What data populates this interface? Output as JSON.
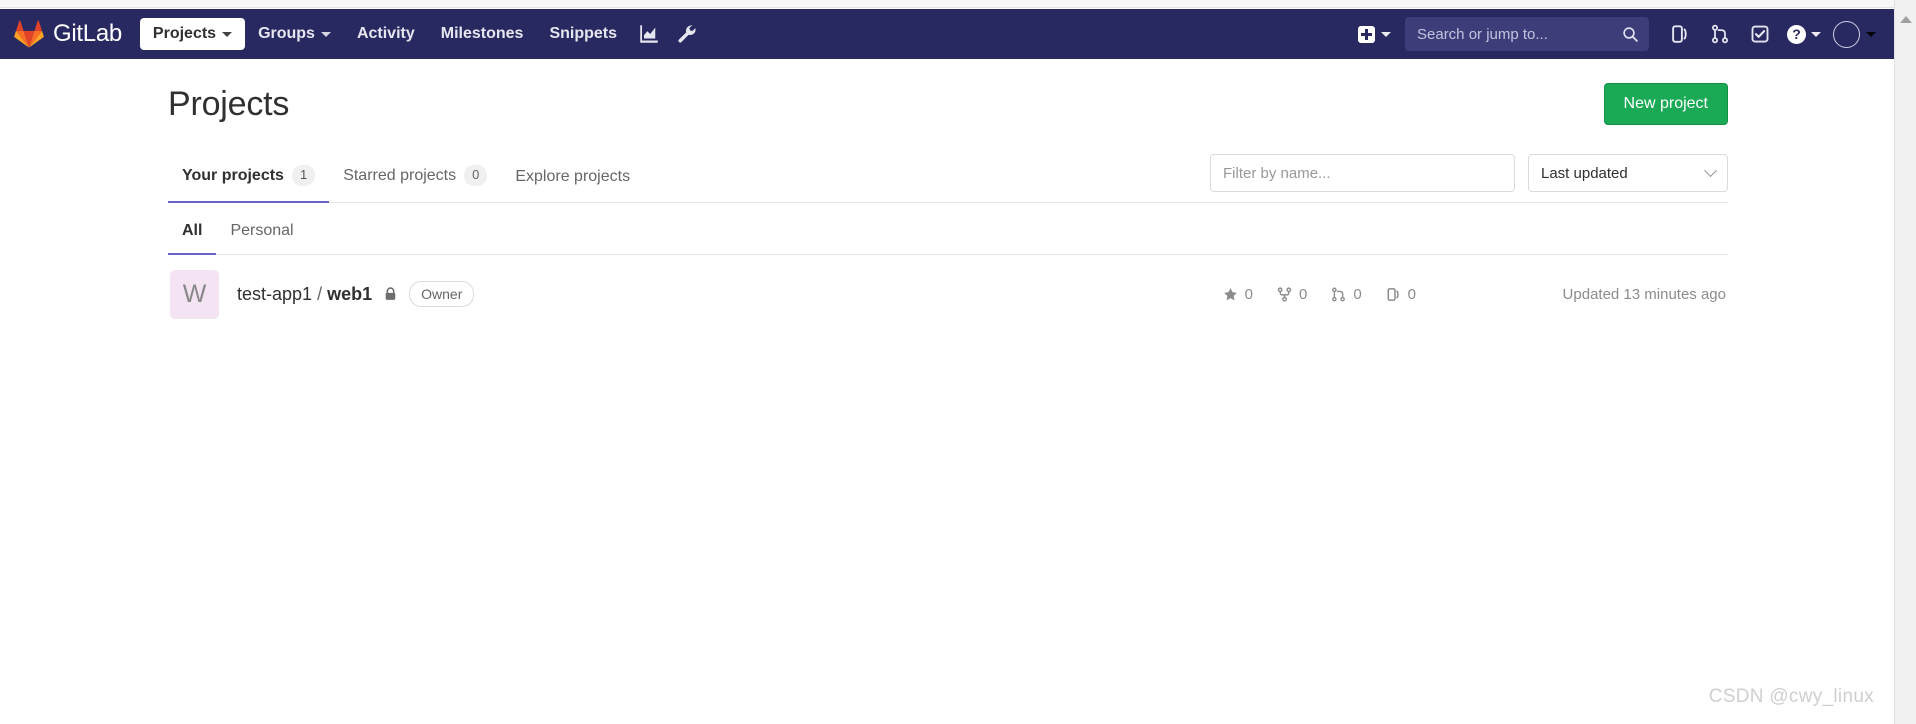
{
  "navbar": {
    "brand": "GitLab",
    "brand_icon": "gitlab-tanuki-logo",
    "items": [
      {
        "label": "Projects",
        "icon": "chevron-down-icon",
        "active": true,
        "has_caret": true
      },
      {
        "label": "Groups",
        "icon": "chevron-down-icon",
        "active": false,
        "has_caret": true
      },
      {
        "label": "Activity",
        "active": false,
        "has_caret": false
      },
      {
        "label": "Milestones",
        "active": false,
        "has_caret": false
      },
      {
        "label": "Snippets",
        "active": false,
        "has_caret": false
      }
    ],
    "icon_buttons": [
      {
        "name": "analytics-chart-icon"
      },
      {
        "name": "admin-wrench-icon"
      }
    ],
    "create_new": {
      "name": "plus-icon",
      "caret": "chevron-down-icon"
    },
    "search": {
      "placeholder": "Search or jump to...",
      "value": "",
      "icon": "search-icon"
    },
    "right_icons": [
      {
        "name": "issues-icon"
      },
      {
        "name": "merge-requests-icon"
      },
      {
        "name": "todos-done-icon"
      }
    ],
    "help": {
      "glyph": "?",
      "icon": "help-icon",
      "caret": "chevron-down-icon"
    },
    "user_menu": {
      "icon": "avatar-icon",
      "caret": "chevron-down-icon"
    }
  },
  "page": {
    "title": "Projects",
    "new_project_label": "New project"
  },
  "tabs": [
    {
      "label": "Your projects",
      "count": "1",
      "active": true
    },
    {
      "label": "Starred projects",
      "count": "0",
      "active": false
    },
    {
      "label": "Explore projects",
      "count": "",
      "active": false
    }
  ],
  "controls": {
    "filter": {
      "placeholder": "Filter by name...",
      "value": ""
    },
    "sort": {
      "selected": "Last updated",
      "icon": "chevron-down-icon"
    }
  },
  "subtabs": [
    {
      "label": "All",
      "active": true
    },
    {
      "label": "Personal",
      "active": false
    }
  ],
  "projects": [
    {
      "avatar_letter": "W",
      "avatar_color": "#f3e3f3",
      "namespace": "test-app1",
      "separator": "/",
      "name": "web1",
      "visibility_icon": "lock-icon",
      "role_badge": "Owner",
      "stats": [
        {
          "icon": "star-icon",
          "value": "0"
        },
        {
          "icon": "fork-icon",
          "value": "0"
        },
        {
          "icon": "merge-request-icon",
          "value": "0"
        },
        {
          "icon": "issue-icon",
          "value": "0"
        }
      ],
      "updated": "Updated 13 minutes ago"
    }
  ],
  "watermark": "CSDN @cwy_linux",
  "colors": {
    "navbar_bg": "#292961",
    "accent_green": "#1aaa55",
    "tab_underline": "#6666c4"
  }
}
